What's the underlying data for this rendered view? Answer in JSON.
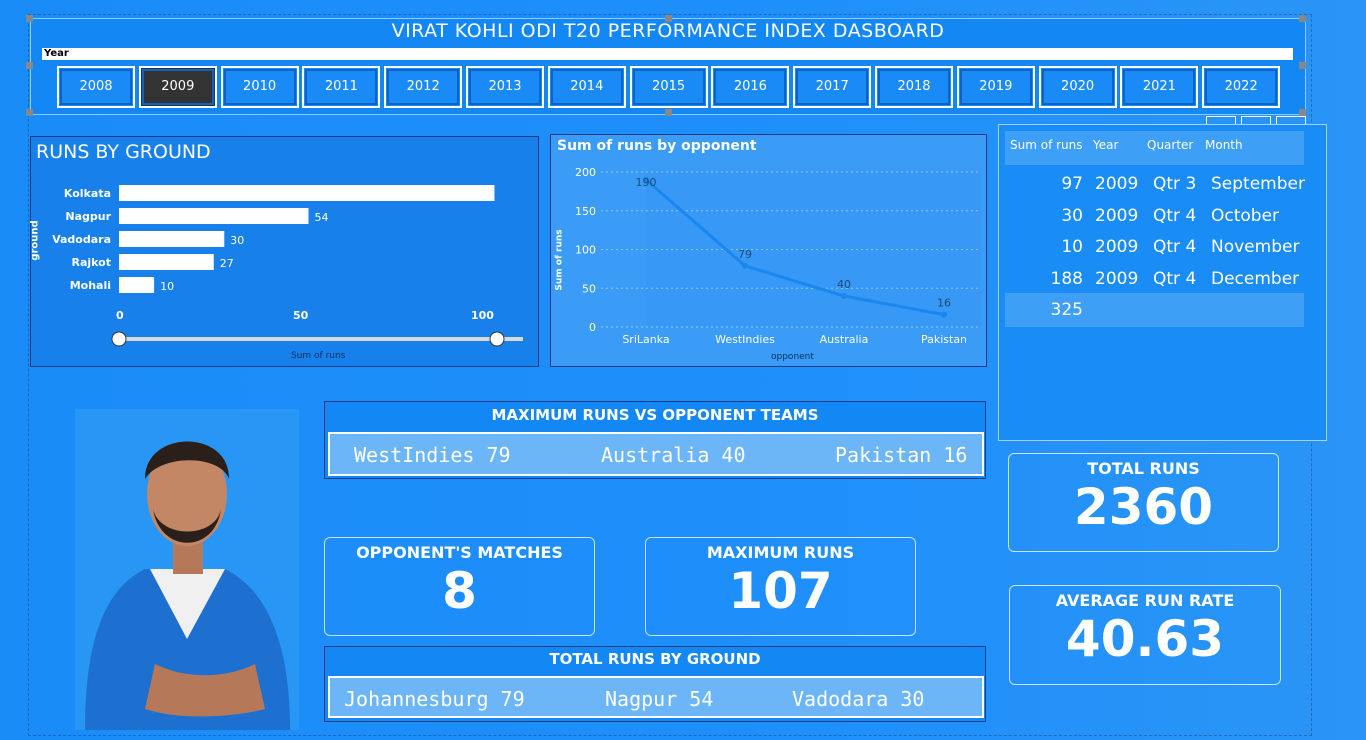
{
  "header": {
    "title": "VIRAT KOHLI ODI T20 PERFORMANCE INDEX DASBOARD",
    "year_label": "Year",
    "years": [
      "2008",
      "2009",
      "2010",
      "2011",
      "2012",
      "2013",
      "2014",
      "2015",
      "2016",
      "2017",
      "2018",
      "2019",
      "2020",
      "2021",
      "2022"
    ],
    "selected_year": "2009"
  },
  "runs_by_ground": {
    "title": "RUNS BY GROUND",
    "y_axis_label": "ground",
    "x_axis_label": "Sum of runs",
    "ticks": [
      "0",
      "50",
      "100"
    ],
    "slider_min": 0,
    "slider_max": 100
  },
  "runs_by_opponent": {
    "title": "Sum of runs by opponent",
    "y_axis_label": "Sum of runs",
    "x_axis_label": "opponent",
    "y_ticks": [
      "200",
      "150",
      "100",
      "50",
      "0"
    ]
  },
  "chart_data": [
    {
      "type": "bar",
      "title": "RUNS BY GROUND",
      "ylabel": "ground",
      "xlabel": "Sum of runs",
      "categories": [
        "Kolkata",
        "Nagpur",
        "Vadodara",
        "Rajkot",
        "Mohali"
      ],
      "values": [
        107,
        54,
        30,
        27,
        10
      ],
      "labels": [
        "",
        "54",
        "30",
        "27",
        "10"
      ],
      "xlim": [
        0,
        110
      ]
    },
    {
      "type": "line",
      "title": "Sum of runs by opponent",
      "ylabel": "Sum of runs",
      "xlabel": "opponent",
      "categories": [
        "SriLanka",
        "WestIndies",
        "Australia",
        "Pakistan"
      ],
      "values": [
        190,
        79,
        40,
        16
      ],
      "ylim": [
        0,
        200
      ]
    }
  ],
  "summary_table": {
    "headers": [
      "Sum of runs",
      "Year",
      "Quarter",
      "Month"
    ],
    "rows": [
      {
        "runs": "97",
        "year": "2009",
        "quarter": "Qtr 3",
        "month": "September"
      },
      {
        "runs": "30",
        "year": "2009",
        "quarter": "Qtr 4",
        "month": "October"
      },
      {
        "runs": "10",
        "year": "2009",
        "quarter": "Qtr 4",
        "month": "November"
      },
      {
        "runs": "188",
        "year": "2009",
        "quarter": "Qtr 4",
        "month": "December"
      }
    ],
    "total": "325"
  },
  "max_runs_vs_opponent": {
    "title": "MAXIMUM RUNS VS OPPONENT TEAMS",
    "items": [
      "WestIndies 79",
      "Australia 40",
      "Pakistan 16"
    ]
  },
  "total_runs_by_ground": {
    "title": "TOTAL RUNS BY GROUND",
    "items": [
      "Johannesburg 79",
      "Nagpur 54",
      "Vadodara 30"
    ]
  },
  "kpis": {
    "total_runs": {
      "label": "TOTAL RUNS",
      "value": "2360"
    },
    "average_run_rate": {
      "label": "AVERAGE RUN RATE",
      "value": "40.63"
    },
    "opponents_matches": {
      "label": "OPPONENT'S MATCHES",
      "value": "8"
    },
    "maximum_runs": {
      "label": "MAXIMUM RUNS",
      "value": "107"
    }
  },
  "colors": {
    "background": "#1f8ffa",
    "panel": "#1780ea",
    "selected_year": "#333333",
    "bar": "#ffffff",
    "line": "#1a86f0"
  }
}
